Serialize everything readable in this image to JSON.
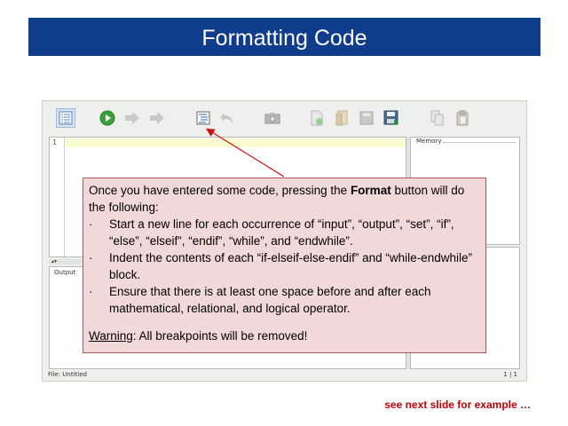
{
  "slide": {
    "title": "Formatting Code",
    "next_note": "see next slide for example …"
  },
  "colors": {
    "title_bar": "#0f3d8c",
    "callout_bg": "#f2d9d9",
    "callout_border": "#b05656",
    "arrow": "#d01010",
    "note_text": "#c00000"
  },
  "toolbar": {
    "buttons": [
      {
        "icon": "list-view-icon",
        "state": "active"
      },
      {
        "icon": "run-icon",
        "state": "enabled"
      },
      {
        "icon": "step-icon",
        "state": "disabled"
      },
      {
        "icon": "fast-forward-icon",
        "state": "disabled"
      },
      {
        "icon": "format-icon",
        "state": "enabled"
      },
      {
        "icon": "undo-icon",
        "state": "disabled"
      },
      {
        "icon": "camera-icon",
        "state": "disabled"
      },
      {
        "icon": "new-file-icon",
        "state": "disabled"
      },
      {
        "icon": "open-file-icon",
        "state": "disabled"
      },
      {
        "icon": "save-icon",
        "state": "disabled"
      },
      {
        "icon": "save-as-icon",
        "state": "enabled"
      },
      {
        "icon": "copy-icon",
        "state": "disabled"
      },
      {
        "icon": "paste-icon",
        "state": "disabled"
      }
    ]
  },
  "editor": {
    "line_number": "1"
  },
  "panels": {
    "memory_label": "Memory",
    "output_label": "Output"
  },
  "status": {
    "file": "File: Untitled",
    "position": "1 | 1"
  },
  "callout": {
    "intro_before": "Once you have entered some code, pressing the ",
    "intro_bold": "Format",
    "intro_after": " button will do the following:",
    "bullet_char": "·",
    "bullets": [
      "Start a new line for each occurrence of “input”, “output”, “set”, “if”, “else”, “elseif”, “endif”, “while”, and “endwhile”.",
      "Indent the contents of each “if-elseif-else-endif” and “while-endwhile” block.",
      "Ensure that there is at least one space before and after each mathematical, relational, and logical operator."
    ],
    "warning_label": "Warning",
    "warning_text": ": All breakpoints will be removed!"
  }
}
